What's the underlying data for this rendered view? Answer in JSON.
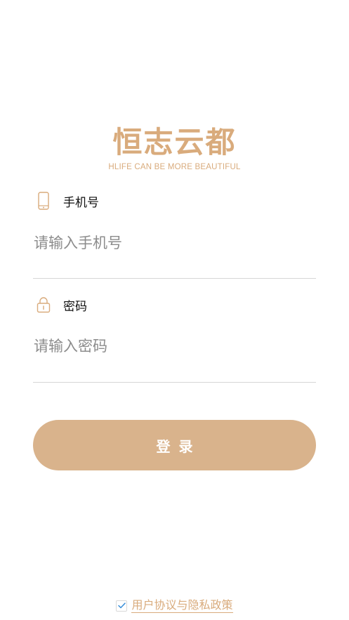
{
  "brand": {
    "title": "恒志云都",
    "tagline": "HLIFE CAN BE MORE BEAUTIFUL",
    "color": "#d9ab7c"
  },
  "phone": {
    "icon": "phone-icon",
    "label": "手机号",
    "placeholder": "请输入手机号",
    "value": ""
  },
  "password": {
    "icon": "lock-icon",
    "label": "密码",
    "placeholder": "请输入密码",
    "value": ""
  },
  "login": {
    "label": "登录",
    "color": "#d9b38c"
  },
  "agreement": {
    "checked": true,
    "link_text": "用户协议与隐私政策"
  }
}
